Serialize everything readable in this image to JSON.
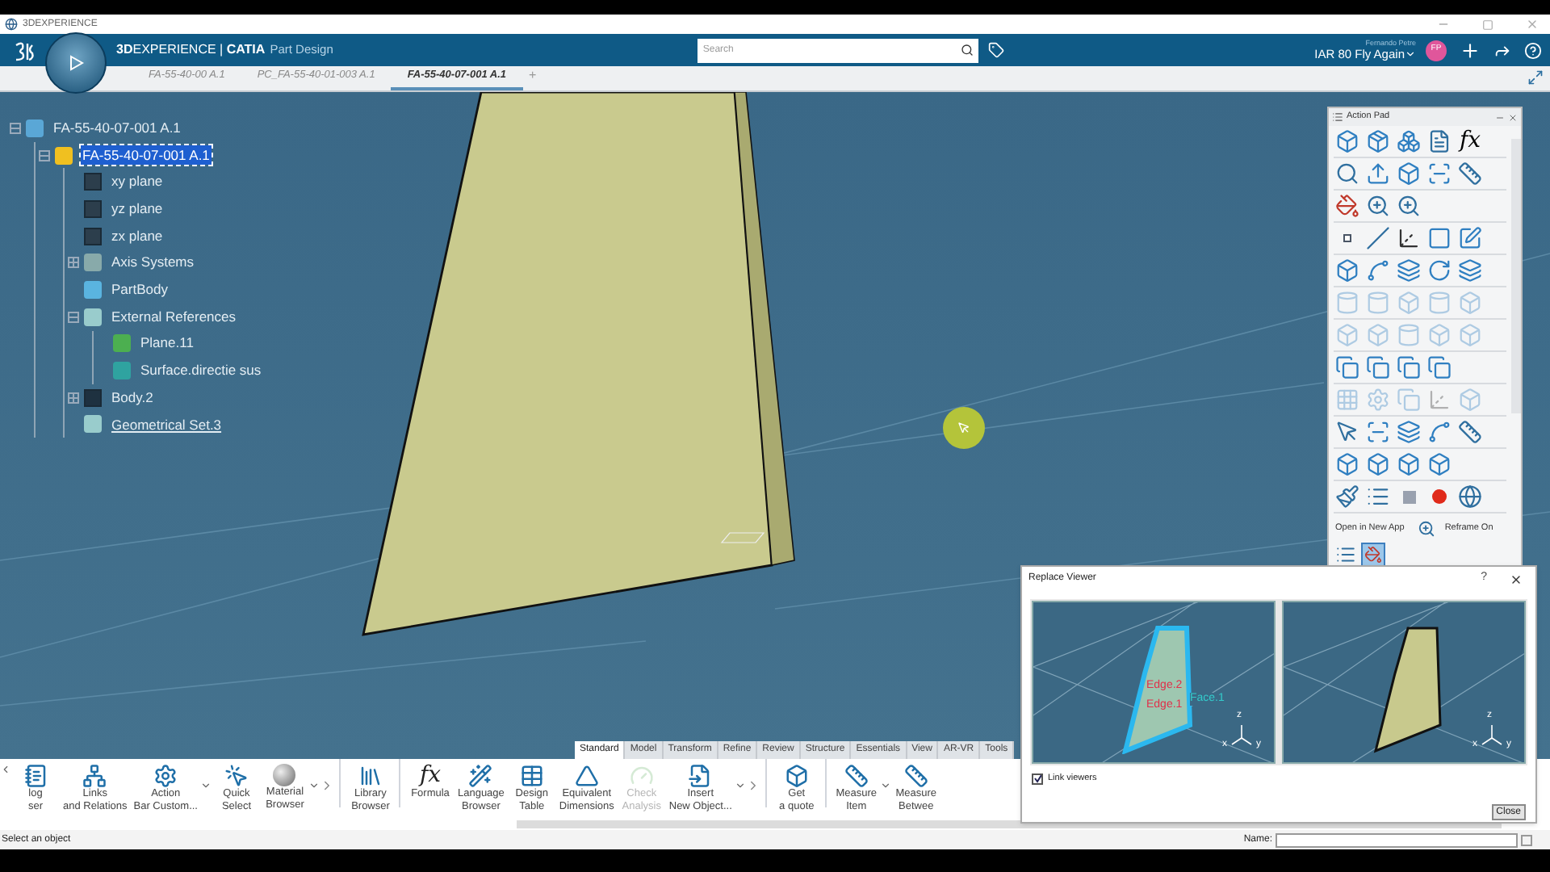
{
  "os_bar": {
    "title": "3DEXPERIENCE"
  },
  "header": {
    "brand": "**3D**EXPERIENCE | **CATIA**",
    "app": "Part Design",
    "search": {
      "placeholder": "Search"
    },
    "user_name": "Fernando Petre",
    "space": "IAR 80 Fly Again",
    "avatar": "FP"
  },
  "tabs": [
    {
      "label": "FA-55-40-00 A.1",
      "selected": false
    },
    {
      "label": "PC_FA-55-40-01-003 A.1",
      "selected": false
    },
    {
      "label": "FA-55-40-07-001 A.1",
      "selected": true
    }
  ],
  "new_tab": "+",
  "tree": [
    {
      "label": "FA-55-40-07-001 A.1",
      "kind": "product",
      "expanded": true,
      "selected": false,
      "current": false,
      "children": [
        {
          "label": "FA-55-40-07-001 A.1",
          "kind": "part",
          "expanded": true,
          "selected": true,
          "current": false,
          "children": [
            {
              "label": "xy plane",
              "kind": "plane",
              "selected": false,
              "current": false
            },
            {
              "label": "yz plane",
              "kind": "plane",
              "selected": false,
              "current": false
            },
            {
              "label": "zx plane",
              "kind": "plane",
              "selected": false,
              "current": false
            },
            {
              "label": "Axis Systems",
              "kind": "axis",
              "expanded": false,
              "selected": false,
              "current": false
            },
            {
              "label": "PartBody",
              "kind": "body",
              "selected": false,
              "current": false
            },
            {
              "label": "External References",
              "kind": "geoset",
              "expanded": true,
              "selected": false,
              "current": false,
              "children": [
                {
                  "label": "Plane.11",
                  "kind": "ref-plane",
                  "selected": false,
                  "current": false
                },
                {
                  "label": "Surface.directie sus",
                  "kind": "ref-surface",
                  "selected": false,
                  "current": false
                }
              ]
            },
            {
              "label": "Body.2",
              "kind": "body-dark",
              "expanded": false,
              "selected": false,
              "current": false
            },
            {
              "label": "Geometrical Set.3",
              "kind": "geoset",
              "selected": false,
              "current": true
            }
          ]
        }
      ]
    }
  ],
  "action_pad": {
    "title": "Action Pad",
    "rows": [
      {
        "disabled": false,
        "tools": [
          {
            "kind": "cube"
          },
          {
            "kind": "part"
          },
          {
            "kind": "assembly"
          },
          {
            "kind": "table"
          },
          {
            "kind": "text",
            "label": "fx"
          }
        ]
      },
      {
        "disabled": false,
        "tools": [
          {
            "kind": "search"
          },
          {
            "kind": "publish"
          },
          {
            "kind": "cube"
          },
          {
            "kind": "scan"
          },
          {
            "kind": "measure"
          }
        ]
      },
      {
        "disabled": false,
        "tools": [
          {
            "kind": "paint"
          },
          {
            "kind": "zoom"
          },
          {
            "kind": "zoom"
          }
        ]
      },
      {
        "disabled": false,
        "tools": [
          {
            "kind": "point"
          },
          {
            "kind": "line"
          },
          {
            "kind": "axis"
          },
          {
            "kind": "plane"
          },
          {
            "kind": "sketch"
          }
        ]
      },
      {
        "disabled": false,
        "tools": [
          {
            "kind": "cube"
          },
          {
            "kind": "curve"
          },
          {
            "kind": "surface"
          },
          {
            "kind": "helix"
          },
          {
            "kind": "surface"
          }
        ]
      },
      {
        "disabled": true,
        "tools": [
          {
            "kind": "cylinder"
          },
          {
            "kind": "cylinder"
          },
          {
            "kind": "cube"
          },
          {
            "kind": "cylinder"
          },
          {
            "kind": "cube"
          }
        ]
      },
      {
        "disabled": true,
        "tools": [
          {
            "kind": "cube"
          },
          {
            "kind": "cube"
          },
          {
            "kind": "cylinder"
          },
          {
            "kind": "cube"
          },
          {
            "kind": "cube"
          }
        ]
      },
      {
        "disabled": false,
        "tools": [
          {
            "kind": "copy"
          },
          {
            "kind": "copy"
          },
          {
            "kind": "copy"
          },
          {
            "kind": "copy"
          }
        ]
      },
      {
        "disabled": true,
        "tools": [
          {
            "kind": "grid"
          },
          {
            "kind": "gear"
          },
          {
            "kind": "copy"
          },
          {
            "kind": "axis"
          },
          {
            "kind": "cube"
          }
        ]
      },
      {
        "disabled": false,
        "tools": [
          {
            "kind": "pointer"
          },
          {
            "kind": "scan"
          },
          {
            "kind": "surface"
          },
          {
            "kind": "curve"
          },
          {
            "kind": "measure"
          }
        ]
      },
      {
        "disabled": false,
        "tools": [
          {
            "kind": "cube"
          },
          {
            "kind": "cube"
          },
          {
            "kind": "cube"
          },
          {
            "kind": "cube"
          }
        ]
      },
      {
        "disabled": false,
        "tools": [
          {
            "kind": "brush"
          },
          {
            "kind": "list"
          },
          {
            "kind": "stop"
          },
          {
            "kind": "record"
          },
          {
            "kind": "globe"
          }
        ]
      }
    ],
    "open_label": "Open in New App",
    "reframe_label": "Reframe On",
    "bottom_tools": [
      {
        "kind": "list",
        "selected": false
      },
      {
        "kind": "paint",
        "selected": true
      }
    ]
  },
  "workbench_tabs": [
    {
      "label": "Standard",
      "selected": true
    },
    {
      "label": "Model",
      "selected": false
    },
    {
      "label": "Transform",
      "selected": false
    },
    {
      "label": "Refine",
      "selected": false
    },
    {
      "label": "Review",
      "selected": false
    },
    {
      "label": "Structure",
      "selected": false
    },
    {
      "label": "Essentials",
      "selected": false
    },
    {
      "label": "View",
      "selected": false
    },
    {
      "label": "AR-VR",
      "selected": false
    },
    {
      "label": "Tools",
      "selected": false
    }
  ],
  "toolbar": [
    {
      "kind": "notebook",
      "lines": [
        "log",
        "ser"
      ],
      "dropdown": false,
      "disabled": false
    },
    {
      "kind": "links",
      "lines": [
        "Links",
        "and Relations"
      ],
      "dropdown": false,
      "disabled": false
    },
    {
      "kind": "action-bar",
      "lines": [
        "Action",
        "Bar Custom..."
      ],
      "dropdown": true,
      "disabled": false
    },
    {
      "kind": "quick-select",
      "lines": [
        "Quick",
        "Select"
      ],
      "dropdown": false,
      "disabled": false
    },
    {
      "kind": "material",
      "lines": [
        "Material",
        "Browser"
      ],
      "dropdown": true,
      "disabled": false
    },
    {
      "kind": "more"
    },
    {
      "kind": "separator"
    },
    {
      "kind": "library",
      "lines": [
        "Library",
        "Browser"
      ],
      "dropdown": false,
      "disabled": false
    },
    {
      "kind": "separator"
    },
    {
      "kind": "formula",
      "glyph": "fx",
      "lines": [
        "Formula"
      ],
      "dropdown": false,
      "disabled": false
    },
    {
      "kind": "language",
      "lines": [
        "Language",
        "Browser"
      ],
      "dropdown": false,
      "disabled": false
    },
    {
      "kind": "table",
      "lines": [
        "Design",
        "Table"
      ],
      "dropdown": false,
      "disabled": false
    },
    {
      "kind": "equivalent",
      "lines": [
        "Equivalent",
        "Dimensions"
      ],
      "dropdown": false,
      "disabled": false
    },
    {
      "kind": "check",
      "lines": [
        "Check",
        "Analysis"
      ],
      "dropdown": false,
      "disabled": true
    },
    {
      "kind": "insert",
      "lines": [
        "Insert",
        "New Object..."
      ],
      "dropdown": true,
      "disabled": false
    },
    {
      "kind": "more"
    },
    {
      "kind": "separator"
    },
    {
      "kind": "quote",
      "lines": [
        "Get",
        "a quote"
      ],
      "dropdown": false,
      "disabled": false
    },
    {
      "kind": "separator"
    },
    {
      "kind": "measure",
      "lines": [
        "Measure",
        "Item"
      ],
      "dropdown": true,
      "disabled": false
    },
    {
      "kind": "measure",
      "lines": [
        "Measure",
        "Betwee"
      ],
      "dropdown": false,
      "disabled": false
    }
  ],
  "status_bar": {
    "message": "Select an object",
    "name_label": "Name:"
  },
  "dialog": {
    "title": "Replace Viewer",
    "help": "?",
    "viewers": [
      {
        "highlighted": true,
        "labels": [
          "Edge.2",
          "Face.1",
          "Edge.1"
        ],
        "axes": [
          "z",
          "x",
          "y"
        ]
      },
      {
        "highlighted": false,
        "axes": [
          "z",
          "x",
          "y"
        ]
      }
    ],
    "link_viewers": {
      "label": "Link viewers",
      "checked": true
    },
    "close": "Close"
  }
}
